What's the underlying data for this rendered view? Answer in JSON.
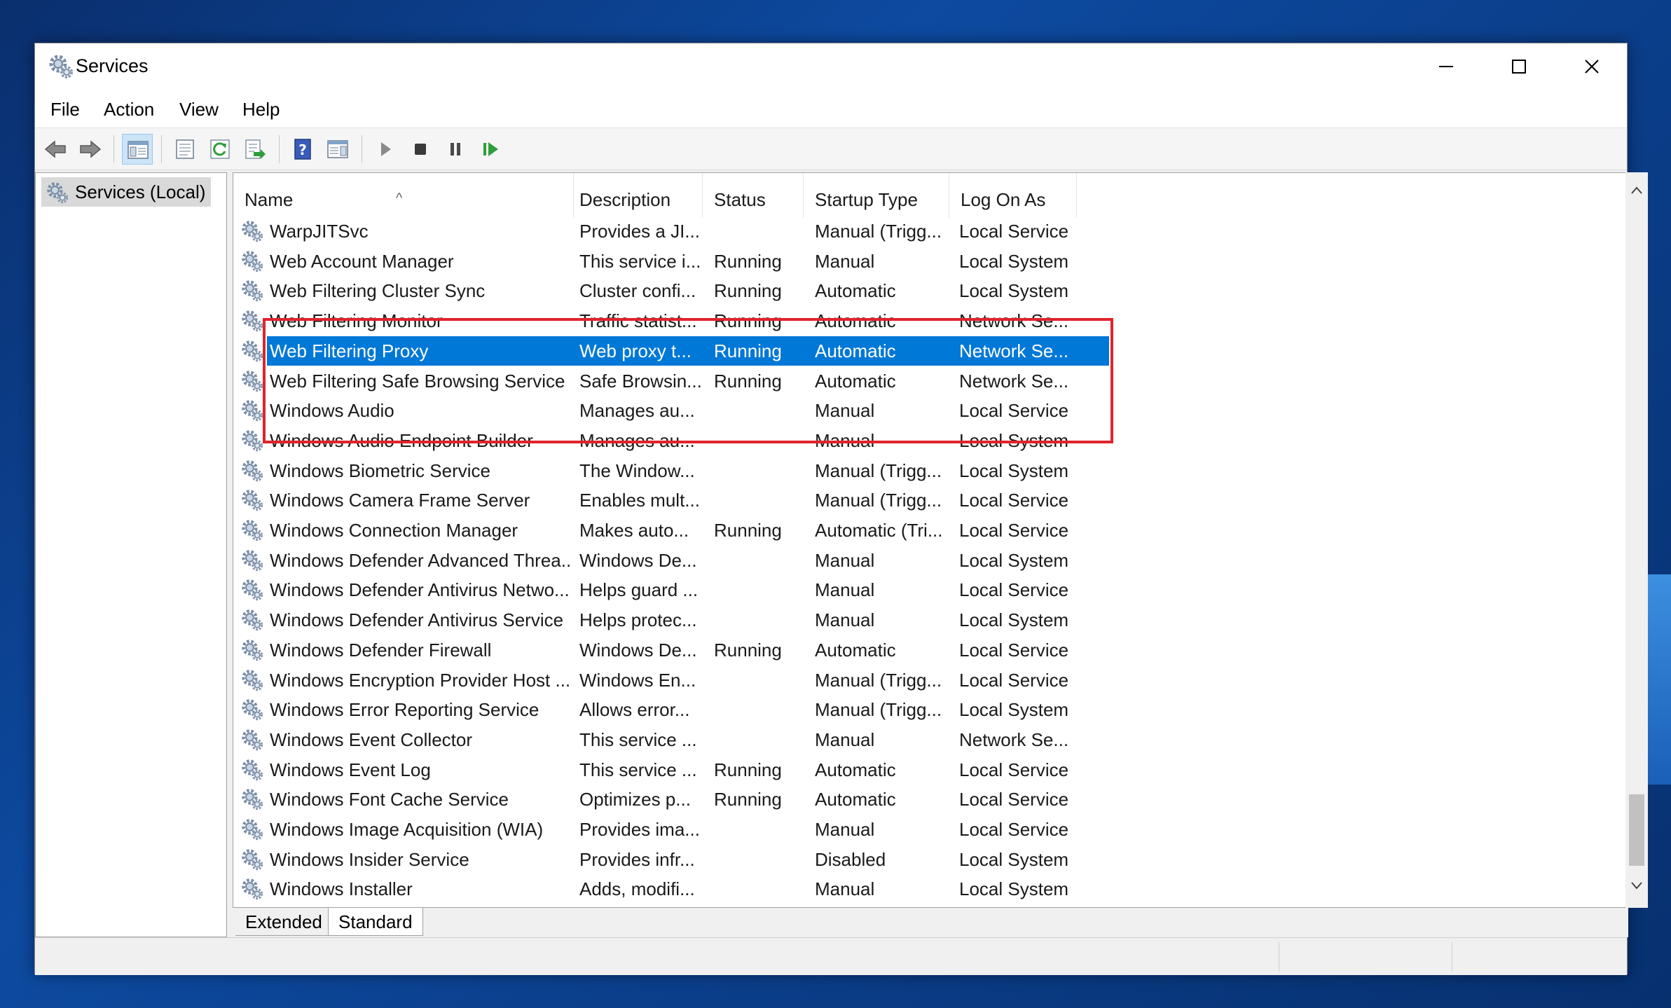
{
  "window": {
    "title": "Services"
  },
  "menubar": {
    "items": [
      "File",
      "Action",
      "View",
      "Help"
    ]
  },
  "toolbar": {
    "buttons": [
      "back-arrow-icon",
      "forward-arrow-icon",
      "show-hide-console-tree-icon",
      "properties-icon",
      "refresh-icon",
      "export-list-icon",
      "help-icon",
      "show-action-pane-icon",
      "start-service-icon",
      "stop-service-icon",
      "pause-service-icon",
      "resume-service-icon"
    ]
  },
  "tree": {
    "root_label": "Services (Local)"
  },
  "table": {
    "columns": [
      "Name",
      "Description",
      "Status",
      "Startup Type",
      "Log On As"
    ],
    "rows": [
      {
        "name": "WarpJITSvc",
        "description": "Provides a JI...",
        "status": "",
        "startup": "Manual (Trigg...",
        "logon": "Local Service"
      },
      {
        "name": "Web Account Manager",
        "description": "This service i...",
        "status": "Running",
        "startup": "Manual",
        "logon": "Local System"
      },
      {
        "name": "Web Filtering Cluster Sync",
        "description": "Cluster confi...",
        "status": "Running",
        "startup": "Automatic",
        "logon": "Local System"
      },
      {
        "name": "Web Filtering Monitor",
        "description": "Traffic statist...",
        "status": "Running",
        "startup": "Automatic",
        "logon": "Network Se..."
      },
      {
        "name": "Web Filtering Proxy",
        "description": "Web proxy t...",
        "status": "Running",
        "startup": "Automatic",
        "logon": "Network Se..."
      },
      {
        "name": "Web Filtering Safe Browsing Service",
        "description": "Safe Browsin...",
        "status": "Running",
        "startup": "Automatic",
        "logon": "Network Se..."
      },
      {
        "name": "Windows Audio",
        "description": "Manages au...",
        "status": "",
        "startup": "Manual",
        "logon": "Local Service"
      },
      {
        "name": "Windows Audio Endpoint Builder",
        "description": "Manages au...",
        "status": "",
        "startup": "Manual",
        "logon": "Local System"
      },
      {
        "name": "Windows Biometric Service",
        "description": "The Window...",
        "status": "",
        "startup": "Manual (Trigg...",
        "logon": "Local System"
      },
      {
        "name": "Windows Camera Frame Server",
        "description": "Enables mult...",
        "status": "",
        "startup": "Manual (Trigg...",
        "logon": "Local Service"
      },
      {
        "name": "Windows Connection Manager",
        "description": "Makes auto...",
        "status": "Running",
        "startup": "Automatic (Tri...",
        "logon": "Local Service"
      },
      {
        "name": "Windows Defender Advanced Threa...",
        "description": "Windows De...",
        "status": "",
        "startup": "Manual",
        "logon": "Local System"
      },
      {
        "name": "Windows Defender Antivirus Netwo...",
        "description": "Helps guard ...",
        "status": "",
        "startup": "Manual",
        "logon": "Local Service"
      },
      {
        "name": "Windows Defender Antivirus Service",
        "description": "Helps protec...",
        "status": "",
        "startup": "Manual",
        "logon": "Local System"
      },
      {
        "name": "Windows Defender Firewall",
        "description": "Windows De...",
        "status": "Running",
        "startup": "Automatic",
        "logon": "Local Service"
      },
      {
        "name": "Windows Encryption Provider Host ...",
        "description": "Windows En...",
        "status": "",
        "startup": "Manual (Trigg...",
        "logon": "Local Service"
      },
      {
        "name": "Windows Error Reporting Service",
        "description": "Allows error...",
        "status": "",
        "startup": "Manual (Trigg...",
        "logon": "Local System"
      },
      {
        "name": "Windows Event Collector",
        "description": "This service ...",
        "status": "",
        "startup": "Manual",
        "logon": "Network Se..."
      },
      {
        "name": "Windows Event Log",
        "description": "This service ...",
        "status": "Running",
        "startup": "Automatic",
        "logon": "Local Service"
      },
      {
        "name": "Windows Font Cache Service",
        "description": "Optimizes p...",
        "status": "Running",
        "startup": "Automatic",
        "logon": "Local Service"
      },
      {
        "name": "Windows Image Acquisition (WIA)",
        "description": "Provides ima...",
        "status": "",
        "startup": "Manual",
        "logon": "Local Service"
      },
      {
        "name": "Windows Insider Service",
        "description": "Provides infr...",
        "status": "",
        "startup": "Disabled",
        "logon": "Local System"
      },
      {
        "name": "Windows Installer",
        "description": "Adds, modifi...",
        "status": "",
        "startup": "Manual",
        "logon": "Local System"
      }
    ],
    "selected_row": "Web Filtering Proxy",
    "highlighted_rows": [
      "Web Filtering Cluster Sync",
      "Web Filtering Monitor",
      "Web Filtering Proxy",
      "Web Filtering Safe Browsing Service"
    ]
  },
  "tabs": {
    "extended": "Extended",
    "standard": "Standard"
  },
  "colors": {
    "selection": "#0078d7",
    "highlight_border": "#e0242d"
  }
}
